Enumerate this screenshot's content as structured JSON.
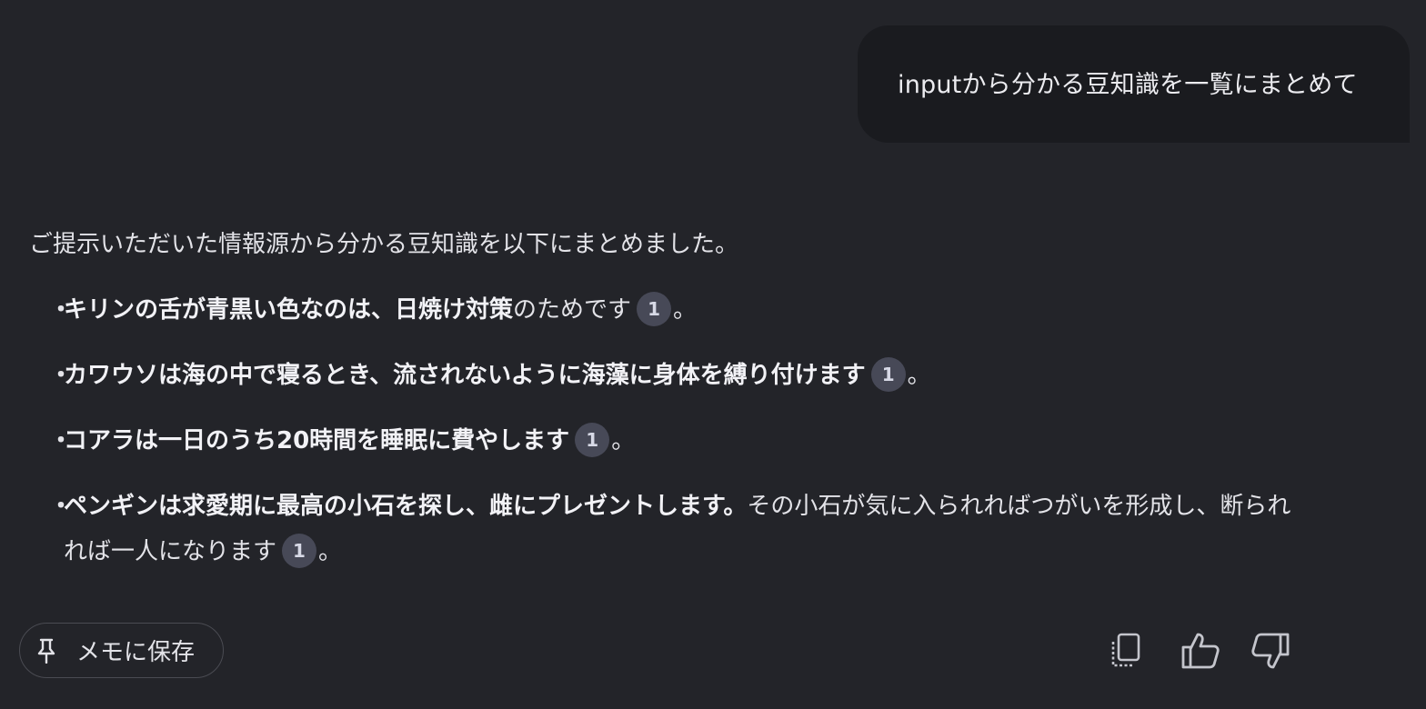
{
  "user_message": {
    "text": "inputから分かる豆知識を一覧にまとめて"
  },
  "response": {
    "intro": "ご提示いただいた情報源から分かる豆知識を以下にまとめました。",
    "bullets": [
      {
        "bold": "キリンの舌が青黒い色なのは、日焼け対策",
        "normal": "のためです",
        "citation": "1",
        "tail": "。"
      },
      {
        "bold": "カワウソは海の中で寝るとき、流されないように海藻に身体を縛り付けます",
        "normal": "",
        "citation": "1",
        "tail": "。"
      },
      {
        "bold": "コアラは一日のうち20時間を睡眠に費やします",
        "normal": "",
        "citation": "1",
        "tail": "。"
      },
      {
        "bold": "ペンギンは求愛期に最高の小石を探し、雌にプレゼントします。",
        "normal": "その小石が気に入られればつがいを形成し、断られれば一人になります",
        "citation": "1",
        "tail": "。"
      }
    ],
    "bullet_glyph": "・"
  },
  "actions": {
    "save_label": "メモに保存",
    "icons": [
      "pin-icon",
      "copy-icon",
      "thumbs-up-icon",
      "thumbs-down-icon"
    ]
  },
  "colors": {
    "background": "#232429",
    "user_bubble": "#1a1b1f",
    "citation_chip": "#474957"
  }
}
